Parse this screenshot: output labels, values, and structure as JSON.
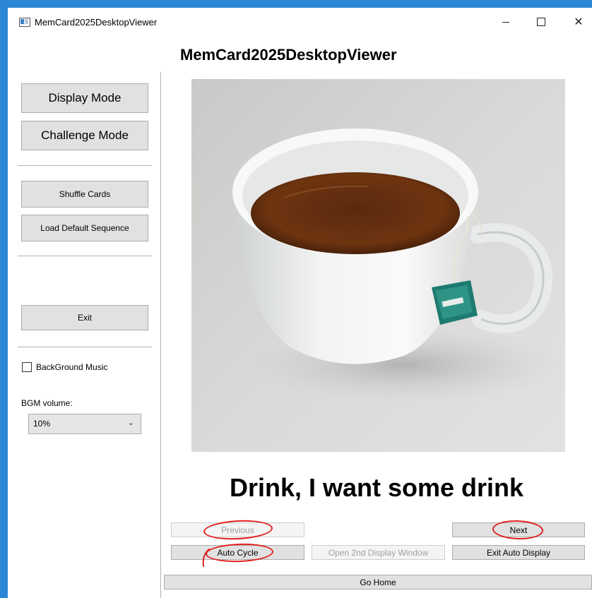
{
  "window": {
    "title": "MemCard2025DesktopViewer",
    "controls": {
      "minimize": "–",
      "maximize": "□",
      "close": "✕"
    },
    "frame_color": "#2b86d6"
  },
  "app": {
    "heading": "MemCard2025DesktopViewer"
  },
  "sidebar": {
    "display_mode": "Display Mode",
    "challenge_mode": "Challenge Mode",
    "shuffle_cards": "Shuffle Cards",
    "load_default_sequence": "Load Default Sequence",
    "exit": "Exit",
    "background_music": {
      "label": "BackGround Music",
      "checked": false
    },
    "bgm_volume": {
      "label": "BGM volume:",
      "selected": "10%"
    }
  },
  "card": {
    "image_icon": "tea-cup-photo",
    "caption": "Drink, I want some drink"
  },
  "controls": {
    "previous": {
      "label": "Previous",
      "enabled": false
    },
    "next": {
      "label": "Next",
      "enabled": true
    },
    "auto_cycle": {
      "label": "Auto Cycle",
      "enabled": true
    },
    "open_second_window": {
      "label": "Open 2nd Display Window",
      "enabled": false
    },
    "exit_auto_display": {
      "label": "Exit Auto Display",
      "enabled": true
    },
    "go_home": {
      "label": "Go Home",
      "enabled": true
    }
  },
  "annotation_color": "#e02020"
}
